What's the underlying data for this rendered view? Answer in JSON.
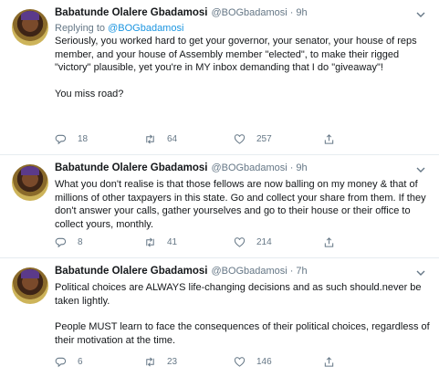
{
  "tweets": [
    {
      "name": "Babatunde Olalere Gbadamosi",
      "handle": "@BOGbadamosi",
      "time": "9h",
      "replying_prefix": "Replying to ",
      "replying_to": "@BOGbadamosi",
      "paragraphs": [
        "Seriously, you worked hard to get your governor, your senator, your house of reps member, and your house of Assembly member \"elected\", to make their rigged \"victory\" plausible, yet you're in MY inbox demanding that I do \"giveaway\"!",
        "You miss road?"
      ],
      "replies": "18",
      "retweets": "64",
      "likes": "257"
    },
    {
      "name": "Babatunde Olalere Gbadamosi",
      "handle": "@BOGbadamosi",
      "time": "9h",
      "paragraphs": [
        "What you don't realise is that those fellows are now balling on my money & that of millions of other taxpayers in this state. Go and collect your share from them. If they don't answer your calls, gather yourselves and go to their house or their office to collect yours, monthly."
      ],
      "replies": "8",
      "retweets": "41",
      "likes": "214"
    },
    {
      "name": "Babatunde Olalere Gbadamosi",
      "handle": "@BOGbadamosi",
      "time": "7h",
      "paragraphs": [
        "Political choices are ALWAYS life-changing decisions and as such should.never be taken lightly.",
        "People MUST learn to face the consequences of their political choices, regardless of their motivation at the time."
      ],
      "replies": "6",
      "retweets": "23",
      "likes": "146"
    }
  ],
  "icons": {
    "reply": "reply-icon",
    "retweet": "retweet-icon",
    "like": "heart-icon",
    "share": "share-icon",
    "menu": "chevron-down-icon"
  },
  "colors": {
    "text": "#14171a",
    "secondary": "#657786",
    "link": "#1b95e0",
    "divider": "#e6ecf0"
  }
}
